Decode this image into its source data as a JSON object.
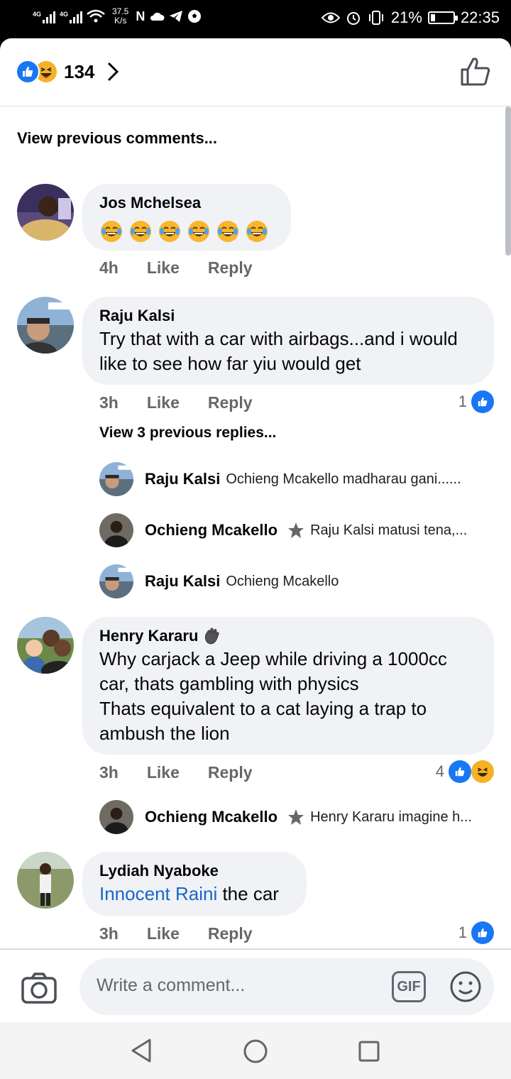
{
  "status_bar": {
    "signal1_label": "4G",
    "signal2_label": "4G",
    "net_speed_value": "37.5",
    "net_speed_unit": "K/s",
    "battery_percent": "21%",
    "battery_level": 0.21,
    "time": "22:35"
  },
  "header": {
    "reaction_count": "134",
    "reactions": [
      "like-icon",
      "haha-icon"
    ]
  },
  "comments_link": "View previous comments...",
  "comments": [
    {
      "author": "Jos Mchelsea",
      "emoji_count": 6,
      "time": "4h",
      "like_label": "Like",
      "reply_label": "Reply"
    },
    {
      "author": "Raju Kalsi",
      "text_lines": [
        "Try that with a car with airbags...and i would",
        "like to see how far yiu would get"
      ],
      "time": "3h",
      "like_label": "Like",
      "reply_label": "Reply",
      "reaction_count": "1",
      "view_replies": "View 3 previous replies...",
      "replies": [
        {
          "author": "Raju Kalsi",
          "text": "Ochieng Mcakello madharau gani......"
        },
        {
          "author": "Ochieng Mcakello",
          "text": "Raju Kalsi matusi tena,..."
        },
        {
          "author": "Raju Kalsi",
          "text": "Ochieng Mcakello"
        }
      ]
    },
    {
      "author": "Henry Kararu",
      "text_lines": [
        "Why carjack a Jeep while driving a 1000cc",
        "car, thats gambling with physics",
        "Thats equivalent to a cat laying a trap to",
        "ambush the lion"
      ],
      "time": "3h",
      "like_label": "Like",
      "reply_label": "Reply",
      "reaction_count": "4",
      "replies": [
        {
          "author": "Ochieng Mcakello",
          "text": "Henry Kararu imagine h..."
        }
      ]
    },
    {
      "author": "Lydiah Nyaboke",
      "mention": "Innocent Raini",
      "text": " the car",
      "time": "3h",
      "like_label": "Like",
      "reply_label": "Reply",
      "reaction_count": "1"
    }
  ],
  "composer": {
    "placeholder": "Write a comment...",
    "gif_label": "GIF"
  },
  "colors": {
    "accent": "#1877f2",
    "haha": "#f7b125",
    "bubble": "#f0f2f5",
    "meta": "#65676b"
  }
}
